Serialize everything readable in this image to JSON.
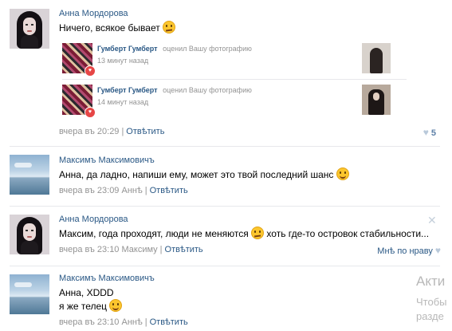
{
  "comments": [
    {
      "author": "Анна Мордорова",
      "text": "Ничего, всякое бывает",
      "date": "вчера въ 20:29",
      "reply": "Отвѣтить",
      "likes": "5"
    },
    {
      "author": "Максимъ Максимовичъ",
      "text": "Анна, да ладно, напиши ему, может это твой последний шанс",
      "date": "вчера въ 23:09",
      "to": "Аннѣ",
      "reply": "Отвѣтить"
    },
    {
      "author": "Анна Мордорова",
      "text_a": "Максим, года проходят, люди не меняются",
      "text_b": "хоть где-то островок стабильности...",
      "date": "вчера въ 23:10",
      "to": "Максиму",
      "reply": "Отвѣтить",
      "like_label": "Мнѣ по нраву"
    },
    {
      "author": "Максимъ Максимовичъ",
      "line1": "Анна, XDDD",
      "line2": "я же телец",
      "date": "вчера въ 23:10",
      "to": "Аннѣ",
      "reply": "Отвѣтить"
    }
  ],
  "notifications": [
    {
      "user": "Гумберт Гумберт",
      "action": "оценил Вашу фотографию",
      "time": "13 минут назад"
    },
    {
      "user": "Гумберт Гумберт",
      "action": "оценил Вашу фотографию",
      "time": "14 минут назад"
    }
  ],
  "watermark": {
    "line1": "Акти",
    "line2": "Чтобы",
    "line3": "разде"
  },
  "icons": {
    "emoji": "smile-emoji",
    "like": "heart-icon",
    "close": "close-icon"
  },
  "colors": {
    "link": "#2a5885",
    "meta": "#939393",
    "separator": "#e7e8ec"
  }
}
